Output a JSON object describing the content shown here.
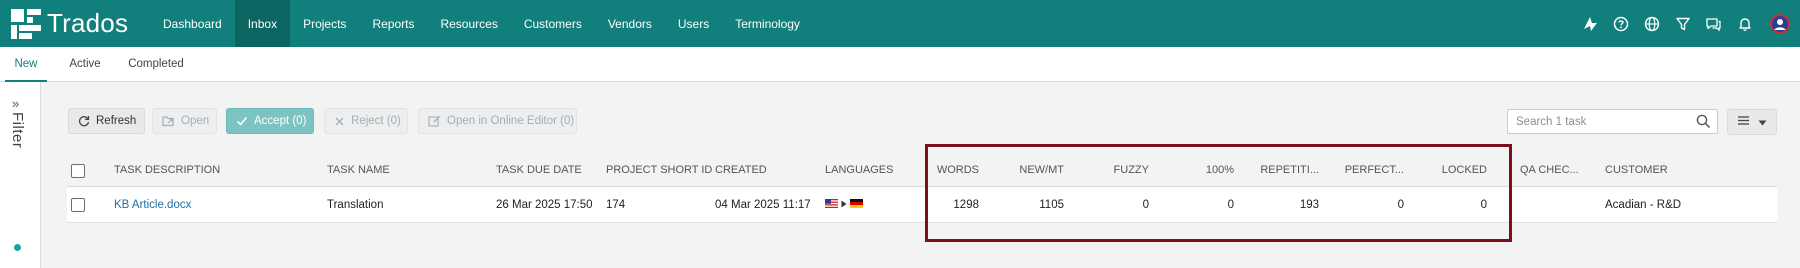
{
  "app": {
    "name": "Trados"
  },
  "nav": {
    "items": [
      {
        "label": "Dashboard"
      },
      {
        "label": "Inbox"
      },
      {
        "label": "Projects"
      },
      {
        "label": "Reports"
      },
      {
        "label": "Resources"
      },
      {
        "label": "Customers"
      },
      {
        "label": "Vendors"
      },
      {
        "label": "Users"
      },
      {
        "label": "Terminology"
      }
    ],
    "active": "Inbox"
  },
  "header_icons": [
    "run-icon",
    "help-icon",
    "globe-icon",
    "filter-icon",
    "chat-icon",
    "notification-icon",
    "user-avatar"
  ],
  "tabs": [
    {
      "label": "New",
      "active": true
    },
    {
      "label": "Active",
      "active": false
    },
    {
      "label": "Completed",
      "active": false
    }
  ],
  "filter_panel": {
    "label": "Filter"
  },
  "toolbar": {
    "refresh": "Refresh",
    "open": "Open",
    "accept": "Accept (0)",
    "reject": "Reject (0)",
    "open_online_editor": "Open in Online Editor (0)"
  },
  "search": {
    "placeholder": "Search 1 task"
  },
  "table": {
    "columns": [
      "TASK DESCRIPTION",
      "TASK NAME",
      "TASK DUE DATE",
      "PROJECT SHORT ID",
      "CREATED",
      "LANGUAGES",
      "WORDS",
      "NEW/MT",
      "FUZZY",
      "100%",
      "REPETITI...",
      "PERFECT...",
      "LOCKED",
      "QA CHEC...",
      "CUSTOMER"
    ],
    "rows": [
      {
        "task_description": "KB Article.docx",
        "task_name": "Translation",
        "due_date": "26 Mar 2025 17:50",
        "project_short_id": "174",
        "created": "04 Mar 2025 11:17",
        "source_language": "en-US",
        "target_language": "de-DE",
        "words": "1298",
        "new_mt": "1105",
        "fuzzy": "0",
        "exact_100": "0",
        "repetitions": "193",
        "perfect": "0",
        "locked": "0",
        "qa_checks": "",
        "customer": "Acadian - R&D"
      }
    ]
  },
  "colors": {
    "header": "#117f7b",
    "header_active": "#0d6562",
    "accent": "#117f7b",
    "accept_button": "#7cc4c2",
    "link": "#1f6fa8",
    "highlight_box": "#7a0f1f"
  }
}
